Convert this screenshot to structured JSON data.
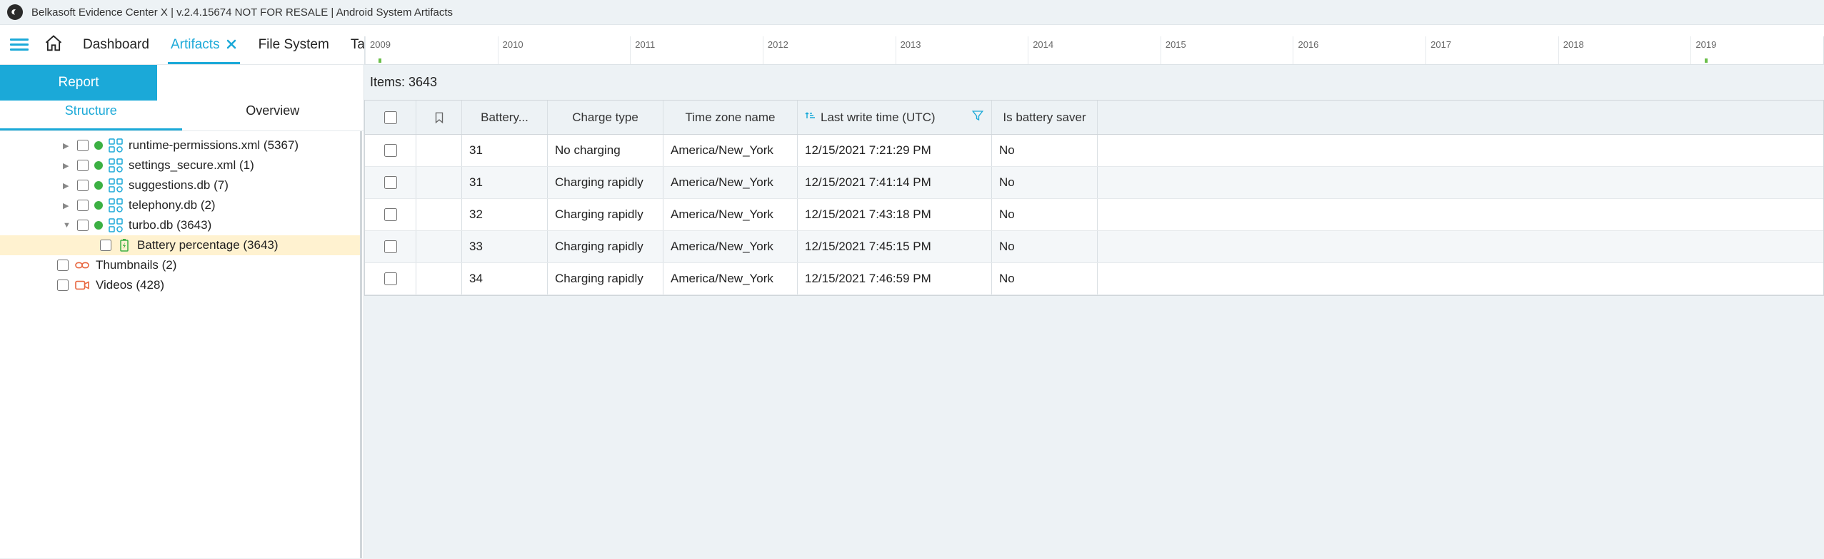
{
  "titlebar": {
    "title": "Belkasoft Evidence Center X | v.2.4.15674 NOT FOR RESALE | Android System Artifacts"
  },
  "nav": {
    "tabs": [
      {
        "label": "Dashboard",
        "active": false,
        "closable": false
      },
      {
        "label": "Artifacts",
        "active": true,
        "closable": true
      },
      {
        "label": "File System",
        "active": false,
        "closable": false
      },
      {
        "label": "Tasks",
        "active": false,
        "closable": false
      }
    ]
  },
  "sidebar": {
    "report_label": "Report",
    "timeline_years": [
      "2009",
      "2010",
      "2011",
      "2012",
      "2013",
      "2014",
      "2015",
      "2016",
      "2017",
      "2018",
      "2019"
    ],
    "tabs": {
      "structure": "Structure",
      "overview": "Overview",
      "active": "structure"
    },
    "tree": [
      {
        "type": "db",
        "label": "runtime-permissions.xml (5367)",
        "expandable": true,
        "expanded": false
      },
      {
        "type": "db",
        "label": "settings_secure.xml (1)",
        "expandable": true,
        "expanded": false
      },
      {
        "type": "db",
        "label": "suggestions.db (7)",
        "expandable": true,
        "expanded": false
      },
      {
        "type": "db",
        "label": "telephony.db (2)",
        "expandable": true,
        "expanded": false
      },
      {
        "type": "db",
        "label": "turbo.db (3643)",
        "expandable": true,
        "expanded": true
      },
      {
        "type": "leaf",
        "label": "Battery percentage (3643)",
        "selected": true,
        "icon": "battery"
      },
      {
        "type": "cat",
        "label": "Thumbnails (2)",
        "icon": "link"
      },
      {
        "type": "cat",
        "label": "Videos (428)",
        "icon": "video"
      }
    ]
  },
  "content": {
    "items_label": "Items: 3643",
    "columns": {
      "battery": "Battery...",
      "charge": "Charge type",
      "tz": "Time zone name",
      "time": "Last write time (UTC)",
      "saver": "Is battery saver"
    },
    "rows": [
      {
        "battery": "31",
        "charge": "No charging",
        "tz": "America/New_York",
        "time": "12/15/2021 7:21:29 PM",
        "saver": "No"
      },
      {
        "battery": "31",
        "charge": "Charging rapidly",
        "tz": "America/New_York",
        "time": "12/15/2021 7:41:14 PM",
        "saver": "No"
      },
      {
        "battery": "32",
        "charge": "Charging rapidly",
        "tz": "America/New_York",
        "time": "12/15/2021 7:43:18 PM",
        "saver": "No"
      },
      {
        "battery": "33",
        "charge": "Charging rapidly",
        "tz": "America/New_York",
        "time": "12/15/2021 7:45:15 PM",
        "saver": "No"
      },
      {
        "battery": "34",
        "charge": "Charging rapidly",
        "tz": "America/New_York",
        "time": "12/15/2021 7:46:59 PM",
        "saver": "No"
      }
    ]
  }
}
